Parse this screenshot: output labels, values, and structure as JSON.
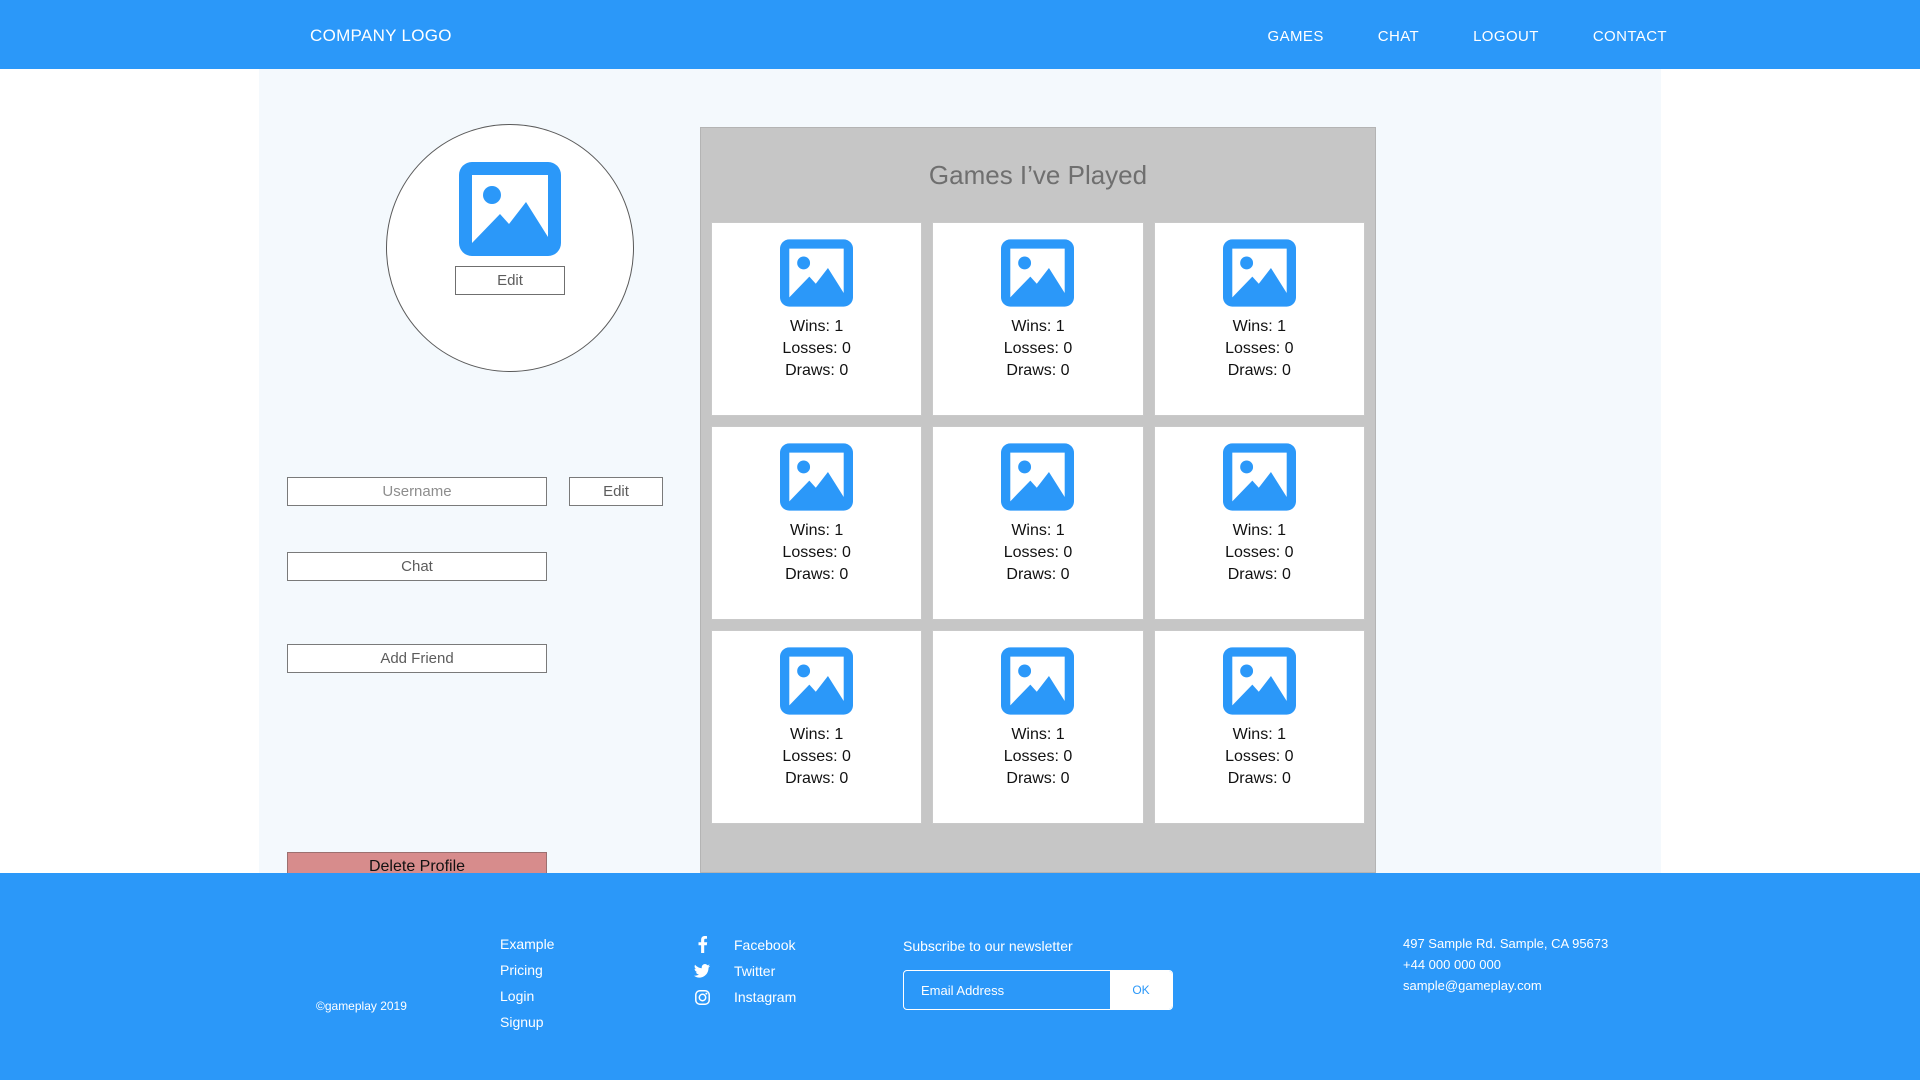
{
  "header": {
    "brand": "COMPANY LOGO",
    "nav": [
      {
        "label": "GAMES"
      },
      {
        "label": "CHAT"
      },
      {
        "label": "LOGOUT"
      },
      {
        "label": "CONTACT"
      }
    ]
  },
  "profile": {
    "avatar_icon": "image-placeholder-icon",
    "edit_avatar_label": "Edit",
    "username_placeholder": "Username",
    "username_value": "",
    "edit_username_label": "Edit",
    "chat_label": "Chat",
    "add_friend_label": "Add Friend",
    "delete_label": "Delete Profile",
    "delete_color": "#d78c8c"
  },
  "games": {
    "title": "Games I’ve Played",
    "panel_color": "#c6c6c6",
    "cards": [
      {
        "icon": "image-placeholder-icon",
        "wins": "Wins: 1",
        "losses": "Losses: 0",
        "draws": "Draws: 0"
      },
      {
        "icon": "image-placeholder-icon",
        "wins": "Wins: 1",
        "losses": "Losses: 0",
        "draws": "Draws: 0"
      },
      {
        "icon": "image-placeholder-icon",
        "wins": "Wins: 1",
        "losses": "Losses: 0",
        "draws": "Draws: 0"
      },
      {
        "icon": "image-placeholder-icon",
        "wins": "Wins: 1",
        "losses": "Losses: 0",
        "draws": "Draws: 0"
      },
      {
        "icon": "image-placeholder-icon",
        "wins": "Wins: 1",
        "losses": "Losses: 0",
        "draws": "Draws: 0"
      },
      {
        "icon": "image-placeholder-icon",
        "wins": "Wins: 1",
        "losses": "Losses: 0",
        "draws": "Draws: 0"
      },
      {
        "icon": "image-placeholder-icon",
        "wins": "Wins: 1",
        "losses": "Losses: 0",
        "draws": "Draws: 0"
      },
      {
        "icon": "image-placeholder-icon",
        "wins": "Wins: 1",
        "losses": "Losses: 0",
        "draws": "Draws: 0"
      },
      {
        "icon": "image-placeholder-icon",
        "wins": "Wins: 1",
        "losses": "Losses: 0",
        "draws": "Draws: 0"
      }
    ]
  },
  "footer": {
    "background": "#2b98f9",
    "copyright": "©gameplay 2019",
    "links": [
      {
        "label": "Example"
      },
      {
        "label": "Pricing"
      },
      {
        "label": "Login"
      },
      {
        "label": "Signup"
      }
    ],
    "socials": [
      {
        "icon": "facebook-icon",
        "label": "Facebook"
      },
      {
        "icon": "twitter-icon",
        "label": "Twitter"
      },
      {
        "icon": "instagram-icon",
        "label": "Instagram"
      }
    ],
    "newsletter": {
      "title": "Subscribe to our newsletter",
      "email_placeholder": "Email Address",
      "email_value": "",
      "ok_label": "OK"
    },
    "contact": {
      "address": "497 Sample Rd. Sample, CA 95673",
      "phone": "+44 000 000 000",
      "email": "sample@gameplay.com"
    }
  }
}
